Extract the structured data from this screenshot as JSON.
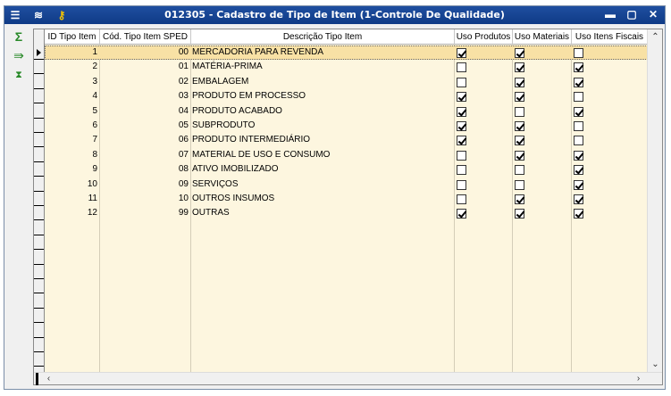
{
  "window": {
    "title": "012305 - Cadastro de Tipo de Item (1-Controle De Qualidade)",
    "controls": {
      "minimize": "▬",
      "maximize": "▢",
      "close": "✕"
    }
  },
  "sidebar": {
    "sum_icon": "Σ",
    "export_icon": "⇛",
    "last_icon": "⧗"
  },
  "grid": {
    "columns": [
      "ID Tipo Item",
      "Cód. Tipo Item SPED",
      "Descrição Tipo Item",
      "Uso Produtos",
      "Uso Materiais",
      "Uso Itens Fiscais"
    ],
    "rows": [
      {
        "id": "1",
        "sped": "00",
        "desc": "MERCADORIA PARA REVENDA",
        "prod": true,
        "mat": true,
        "fisc": false
      },
      {
        "id": "2",
        "sped": "01",
        "desc": "MATÉRIA-PRIMA",
        "prod": false,
        "mat": true,
        "fisc": true
      },
      {
        "id": "3",
        "sped": "02",
        "desc": "EMBALAGEM",
        "prod": false,
        "mat": true,
        "fisc": true
      },
      {
        "id": "4",
        "sped": "03",
        "desc": "PRODUTO EM PROCESSO",
        "prod": true,
        "mat": true,
        "fisc": false
      },
      {
        "id": "5",
        "sped": "04",
        "desc": "PRODUTO ACABADO",
        "prod": true,
        "mat": false,
        "fisc": true
      },
      {
        "id": "6",
        "sped": "05",
        "desc": "SUBPRODUTO",
        "prod": true,
        "mat": true,
        "fisc": false
      },
      {
        "id": "7",
        "sped": "06",
        "desc": "PRODUTO INTERMEDIÁRIO",
        "prod": true,
        "mat": true,
        "fisc": false
      },
      {
        "id": "8",
        "sped": "07",
        "desc": "MATERIAL DE USO E CONSUMO",
        "prod": false,
        "mat": true,
        "fisc": true
      },
      {
        "id": "9",
        "sped": "08",
        "desc": "ATIVO IMOBILIZADO",
        "prod": false,
        "mat": false,
        "fisc": true
      },
      {
        "id": "10",
        "sped": "09",
        "desc": "SERVIÇOS",
        "prod": false,
        "mat": false,
        "fisc": true
      },
      {
        "id": "11",
        "sped": "10",
        "desc": "OUTROS INSUMOS",
        "prod": false,
        "mat": true,
        "fisc": true
      },
      {
        "id": "12",
        "sped": "99",
        "desc": "OUTRAS",
        "prod": true,
        "mat": true,
        "fisc": true
      }
    ],
    "selected_row": 0
  },
  "scroll": {
    "up": "⌃",
    "down": "⌄",
    "left": "‹",
    "right": "›"
  }
}
